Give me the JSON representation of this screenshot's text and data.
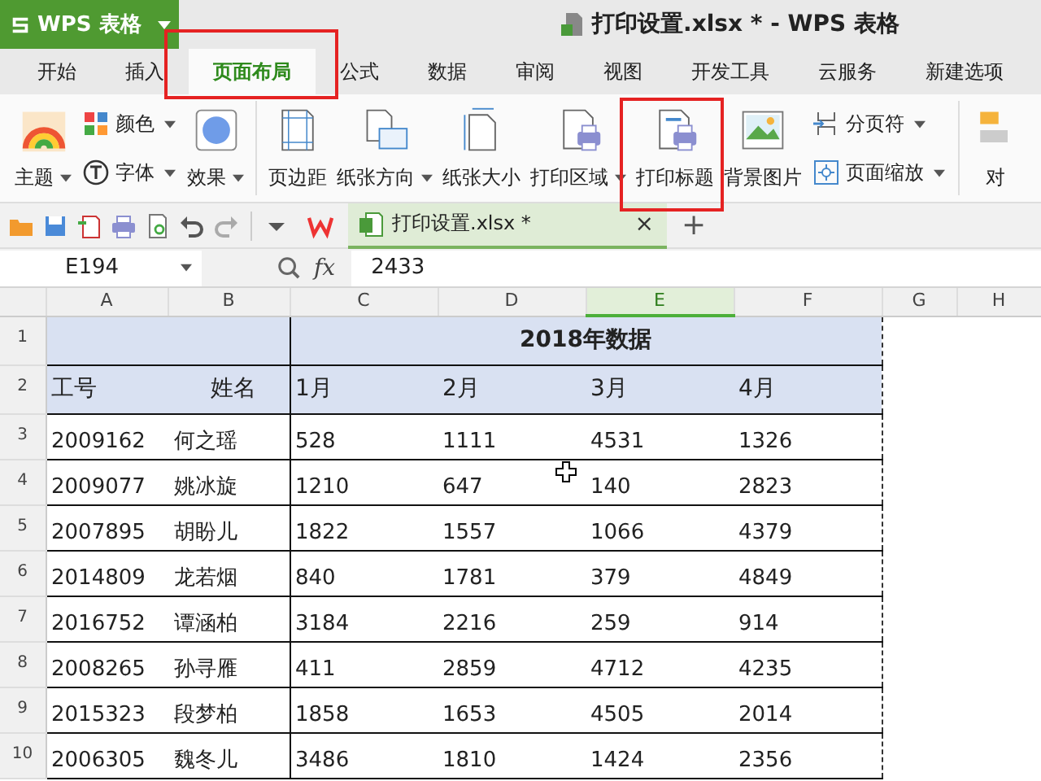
{
  "app_button": {
    "label": "WPS 表格"
  },
  "window": {
    "title": "打印设置.xlsx * - WPS 表格"
  },
  "tabs": [
    {
      "label": "开始",
      "selected": false,
      "highlighted": false
    },
    {
      "label": "插入",
      "selected": false,
      "highlighted": false
    },
    {
      "label": "页面布局",
      "selected": true,
      "highlighted": true
    },
    {
      "label": "公式",
      "selected": false,
      "highlighted": false
    },
    {
      "label": "数据",
      "selected": false,
      "highlighted": false
    },
    {
      "label": "审阅",
      "selected": false,
      "highlighted": false
    },
    {
      "label": "视图",
      "selected": false,
      "highlighted": false
    },
    {
      "label": "开发工具",
      "selected": false,
      "highlighted": false
    },
    {
      "label": "云服务",
      "selected": false,
      "highlighted": false
    },
    {
      "label": "新建选项",
      "selected": false,
      "highlighted": false
    }
  ],
  "ribbon": {
    "groups": [
      {
        "columns": [
          [
            {
              "kind": "large",
              "label": "主题",
              "caret": true,
              "highlighted": false
            }
          ],
          [
            {
              "kind": "small",
              "label": "颜色",
              "caret": true,
              "highlighted": false
            },
            {
              "kind": "small",
              "label": "字体",
              "caret": true,
              "highlighted": false
            }
          ],
          [
            {
              "kind": "large",
              "label": "效果",
              "caret": true,
              "highlighted": false
            }
          ]
        ]
      },
      {
        "columns": [
          [
            {
              "kind": "large",
              "label": "页边距",
              "caret": false,
              "highlighted": false
            }
          ],
          [
            {
              "kind": "large",
              "label": "纸张方向",
              "caret": true,
              "highlighted": false
            }
          ],
          [
            {
              "kind": "large",
              "label": "纸张大小",
              "caret": false,
              "highlighted": false
            }
          ],
          [
            {
              "kind": "large",
              "label": "打印区域",
              "caret": true,
              "highlighted": false
            }
          ],
          [
            {
              "kind": "large",
              "label": "打印标题",
              "caret": false,
              "highlighted": true
            }
          ],
          [
            {
              "kind": "large",
              "label": "背景图片",
              "caret": false,
              "highlighted": false
            }
          ],
          [
            {
              "kind": "small",
              "label": "分页符",
              "caret": true,
              "highlighted": false
            },
            {
              "kind": "small",
              "label": "页面缩放",
              "caret": true,
              "highlighted": false
            }
          ]
        ]
      },
      {
        "columns": [
          [
            {
              "kind": "large",
              "label": "对",
              "caret": false,
              "highlighted": false
            }
          ]
        ]
      }
    ]
  },
  "doc_tab": {
    "label": "打印设置.xlsx *",
    "close": "×",
    "new": "+"
  },
  "formula_bar": {
    "name_box": "E194",
    "fx": "fx",
    "value": "2433"
  },
  "sheet": {
    "columns": [
      {
        "label": "A",
        "selected": false
      },
      {
        "label": "B",
        "selected": false
      },
      {
        "label": "C",
        "selected": false
      },
      {
        "label": "D",
        "selected": false
      },
      {
        "label": "E",
        "selected": true
      },
      {
        "label": "F",
        "selected": false
      },
      {
        "label": "G",
        "selected": false
      },
      {
        "label": "H",
        "selected": false
      }
    ],
    "title_row": {
      "number": "1",
      "title": "2018年数据"
    },
    "header_row": {
      "number": "2",
      "cells": [
        "工号",
        "姓名",
        "1月",
        "2月",
        "3月",
        "4月"
      ]
    },
    "rows": [
      {
        "number": "3",
        "cells": [
          "2009162",
          "何之瑶",
          "528",
          "1111",
          "4531",
          "1326"
        ]
      },
      {
        "number": "4",
        "cells": [
          "2009077",
          "姚冰旋",
          "1210",
          "647",
          "140",
          "2823"
        ]
      },
      {
        "number": "5",
        "cells": [
          "2007895",
          "胡盼儿",
          "1822",
          "1557",
          "1066",
          "4379"
        ]
      },
      {
        "number": "6",
        "cells": [
          "2014809",
          "龙若烟",
          "840",
          "1781",
          "379",
          "4849"
        ]
      },
      {
        "number": "7",
        "cells": [
          "2016752",
          "谭涵柏",
          "3184",
          "2216",
          "259",
          "914"
        ]
      },
      {
        "number": "8",
        "cells": [
          "2008265",
          "孙寻雁",
          "411",
          "2859",
          "4712",
          "4235"
        ]
      },
      {
        "number": "9",
        "cells": [
          "2015323",
          "段梦柏",
          "1858",
          "1653",
          "4505",
          "2014"
        ]
      },
      {
        "number": "10",
        "cells": [
          "2006305",
          "魏冬儿",
          "3486",
          "1810",
          "1424",
          "2356"
        ]
      }
    ]
  }
}
